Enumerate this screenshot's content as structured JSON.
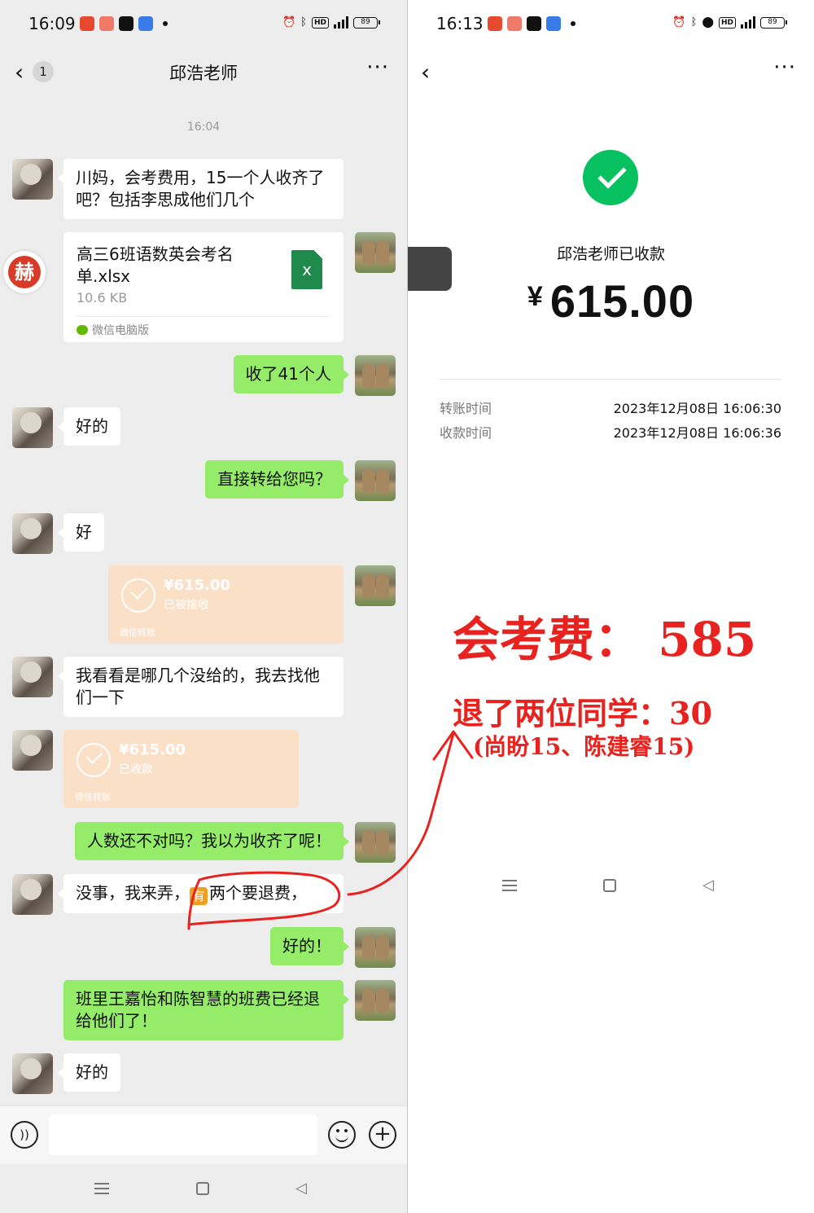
{
  "left": {
    "status": {
      "time": "16:09",
      "battery": "89",
      "network": "5G"
    },
    "nav": {
      "back_count": "1",
      "title": "邱浩老师",
      "more": "···"
    },
    "timestamp": "16:04",
    "messages": {
      "m1": "川妈，会考费用，15一个人收齐了吧？包括李思成他们几个",
      "file": {
        "name": "高三6班语数英会考名单.xlsx",
        "size": "10.6 KB",
        "source": "微信电脑版",
        "icon_letter": "x"
      },
      "m2": "收了41个人",
      "m3": "好的",
      "m4": "直接转给您吗？",
      "m5": "好",
      "transfer1": {
        "amount": "¥615.00",
        "status": "已被接收",
        "source": "微信转账"
      },
      "m6": "我看看是哪几个没给的，我去找他们一下",
      "transfer2": {
        "amount": "¥615.00",
        "status": "已收款",
        "source": "微信转账"
      },
      "m7": "人数还不对吗？我以为收齐了呢！",
      "m8_pre": "没事，我来弄，",
      "m8_emoji": "有",
      "m8_post": "两个要退费，",
      "m9": "好的！",
      "m10": "班里王嘉怡和陈智慧的班费已经退给他们了！",
      "m11": "好的"
    },
    "floating_logo": "赫",
    "input": {
      "placeholder": ""
    }
  },
  "right": {
    "status": {
      "time": "16:13",
      "battery": "89",
      "network": "5G"
    },
    "more": "···",
    "received_label": "邱浩老师已收款",
    "currency": "¥",
    "amount": "615.00",
    "rows": [
      {
        "label": "转账时间",
        "value": "2023年12月08日 16:06:30"
      },
      {
        "label": "收款时间",
        "value": "2023年12月08日 16:06:36"
      }
    ],
    "annotation": {
      "line1": "会考费：  585",
      "line2": "退了两位同学：30",
      "line3": "(尚盼15、陈建睿15)"
    }
  },
  "colors": {
    "wechat_green": "#07c160",
    "bubble_green": "#95ec69",
    "annotation_red": "#e8231f",
    "transfer_orange": "#fbe0c8"
  }
}
